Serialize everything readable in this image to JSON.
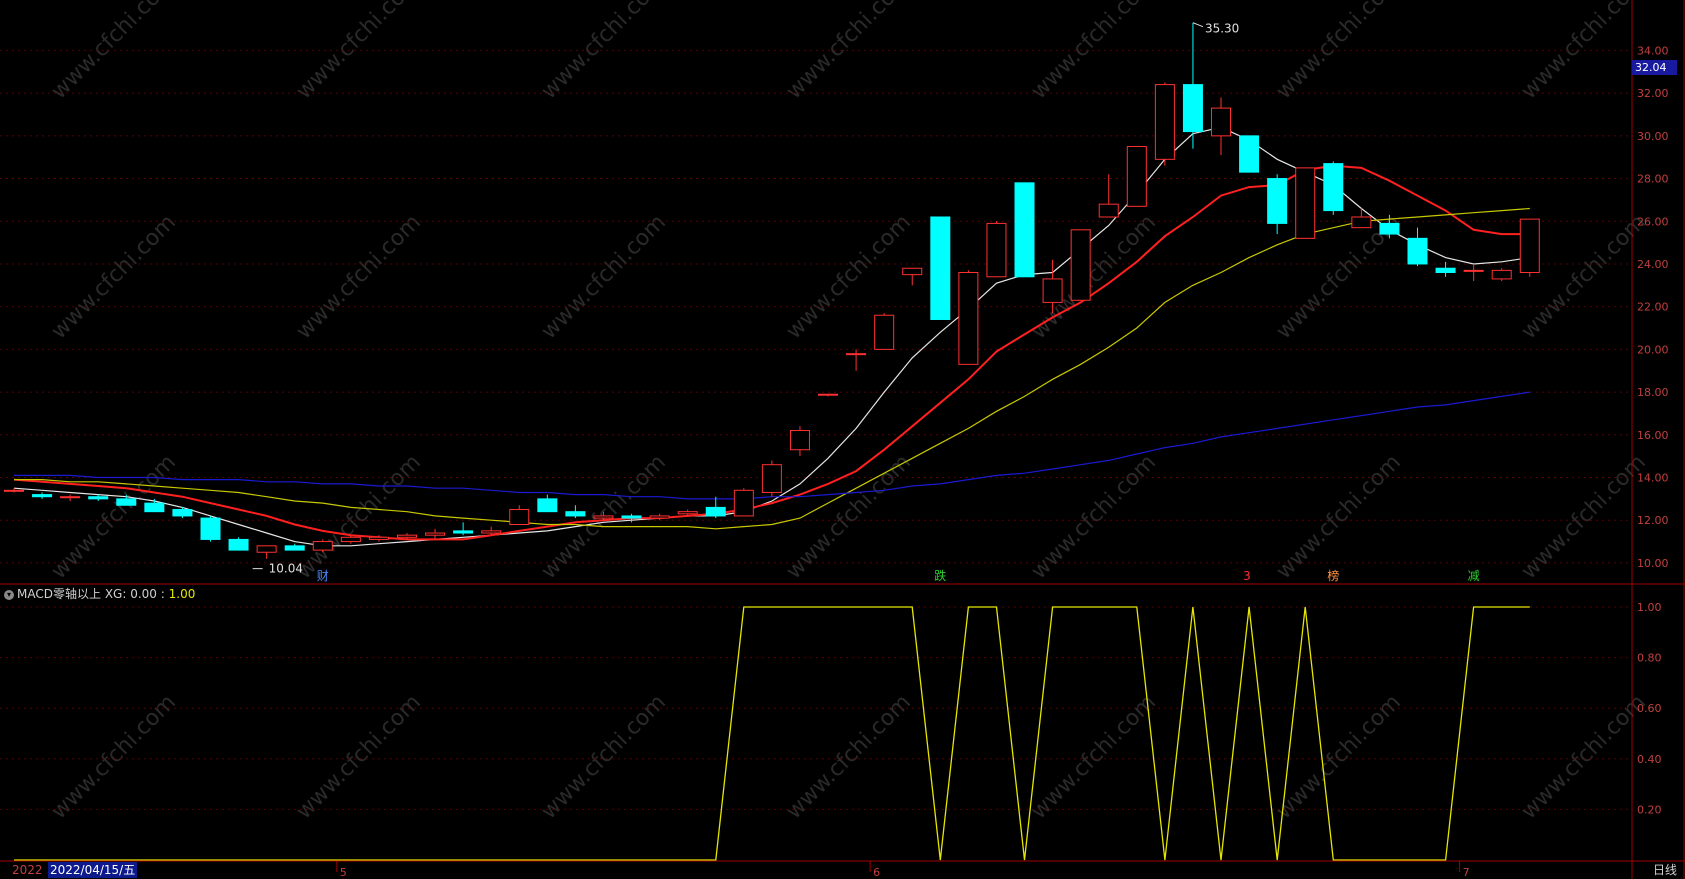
{
  "chart_data": [
    {
      "type": "candlestick",
      "y_ticks": [
        "10.00",
        "12.00",
        "14.00",
        "16.00",
        "18.00",
        "20.00",
        "22.00",
        "24.00",
        "26.00",
        "28.00",
        "30.00",
        "32.00",
        "34.00"
      ],
      "ylim": [
        9.2,
        35.8
      ],
      "x_month_labels": [
        {
          "index": 12,
          "label": "5"
        },
        {
          "index": 31,
          "label": "6"
        },
        {
          "index": 52,
          "label": "7"
        }
      ],
      "candles": [
        [
          13.4,
          13.5,
          13.3,
          13.4
        ],
        [
          13.2,
          13.3,
          13.0,
          13.1
        ],
        [
          13.1,
          13.2,
          12.9,
          13.1
        ],
        [
          13.1,
          13.2,
          12.9,
          13.0
        ],
        [
          13.0,
          13.2,
          12.8,
          12.7
        ],
        [
          12.8,
          13.0,
          12.4,
          12.4
        ],
        [
          12.5,
          12.6,
          12.1,
          12.2
        ],
        [
          12.1,
          12.2,
          11.0,
          11.1
        ],
        [
          11.1,
          11.2,
          10.6,
          10.6
        ],
        [
          10.5,
          10.8,
          10.2,
          10.8
        ],
        [
          10.8,
          10.9,
          10.6,
          10.6
        ],
        [
          10.6,
          11.1,
          10.5,
          11.0
        ],
        [
          11.0,
          11.3,
          10.9,
          11.2
        ],
        [
          11.1,
          11.3,
          11.0,
          11.2
        ],
        [
          11.2,
          11.4,
          11.1,
          11.3
        ],
        [
          11.3,
          11.6,
          11.1,
          11.4
        ],
        [
          11.5,
          11.9,
          11.3,
          11.4
        ],
        [
          11.4,
          11.7,
          11.3,
          11.5
        ],
        [
          11.8,
          12.7,
          11.8,
          12.5
        ],
        [
          13.0,
          13.2,
          12.5,
          12.4
        ],
        [
          12.4,
          12.7,
          12.1,
          12.2
        ],
        [
          12.1,
          12.4,
          12.0,
          12.2
        ],
        [
          12.2,
          12.3,
          11.9,
          12.1
        ],
        [
          12.1,
          12.3,
          12.0,
          12.2
        ],
        [
          12.3,
          12.5,
          12.2,
          12.4
        ],
        [
          12.6,
          13.1,
          12.1,
          12.2
        ],
        [
          12.2,
          13.5,
          12.2,
          13.4
        ],
        [
          13.3,
          14.8,
          13.1,
          14.6
        ],
        [
          15.3,
          16.4,
          15.0,
          16.2
        ],
        [
          17.9,
          17.9,
          17.8,
          17.9
        ],
        [
          19.8,
          20.0,
          19.0,
          19.8
        ],
        [
          20.0,
          21.7,
          20.0,
          21.6
        ],
        [
          23.5,
          23.8,
          23.0,
          23.8
        ],
        [
          26.2,
          26.2,
          21.4,
          21.4
        ],
        [
          19.3,
          23.7,
          19.3,
          23.6
        ],
        [
          23.4,
          26.0,
          23.4,
          25.9
        ],
        [
          27.8,
          27.8,
          23.4,
          23.4
        ],
        [
          22.2,
          24.2,
          21.7,
          23.3
        ],
        [
          22.3,
          25.6,
          22.3,
          25.6
        ],
        [
          26.2,
          28.2,
          26.2,
          26.8
        ],
        [
          26.7,
          29.5,
          26.7,
          29.5
        ],
        [
          28.9,
          32.5,
          28.6,
          32.4
        ],
        [
          32.4,
          35.3,
          29.4,
          30.2
        ],
        [
          30.0,
          31.8,
          29.1,
          31.3
        ],
        [
          30.0,
          30.0,
          28.3,
          28.3
        ],
        [
          28.0,
          28.2,
          25.4,
          25.9
        ],
        [
          25.2,
          28.5,
          25.2,
          28.5
        ],
        [
          28.7,
          28.8,
          26.3,
          26.5
        ],
        [
          25.7,
          26.6,
          25.7,
          26.2
        ],
        [
          25.9,
          26.3,
          25.2,
          25.4
        ],
        [
          25.2,
          25.7,
          23.9,
          24.0
        ],
        [
          23.8,
          24.1,
          23.4,
          23.6
        ],
        [
          23.7,
          24.0,
          23.2,
          23.7
        ],
        [
          23.3,
          23.8,
          23.2,
          23.7
        ],
        [
          23.6,
          24.0,
          23.4,
          26.1
        ]
      ],
      "ma": [
        {
          "color": "#e6e6e6",
          "values": [
            13.5,
            13.4,
            13.3,
            13.2,
            13.1,
            12.9,
            12.6,
            12.2,
            11.8,
            11.4,
            11.0,
            10.8,
            10.8,
            10.9,
            11.0,
            11.1,
            11.2,
            11.3,
            11.4,
            11.5,
            11.7,
            11.9,
            12.0,
            12.1,
            12.2,
            12.2,
            12.4,
            12.9,
            13.7,
            14.9,
            16.3,
            18.0,
            19.6,
            20.8,
            21.9,
            23.1,
            23.5,
            23.6,
            24.7,
            25.8,
            27.3,
            28.9,
            30.1,
            30.4,
            29.8,
            28.9,
            28.3,
            27.7,
            26.6,
            25.6,
            24.9,
            24.3,
            24.0,
            24.1,
            24.3
          ]
        },
        {
          "color": "#ff2020",
          "values": [
            13.9,
            13.8,
            13.7,
            13.6,
            13.5,
            13.3,
            13.1,
            12.8,
            12.5,
            12.2,
            11.8,
            11.5,
            11.3,
            11.2,
            11.1,
            11.1,
            11.1,
            11.3,
            11.5,
            11.7,
            11.9,
            12.0,
            12.1,
            12.1,
            12.2,
            12.3,
            12.5,
            12.8,
            13.2,
            13.7,
            14.3,
            15.3,
            16.4,
            17.5,
            18.6,
            19.9,
            20.7,
            21.5,
            22.2,
            23.1,
            24.1,
            25.3,
            26.2,
            27.2,
            27.6,
            27.7,
            28.4,
            28.6,
            28.5,
            27.9,
            27.2,
            26.5,
            25.6,
            25.4,
            25.4
          ]
        },
        {
          "color": "#c8c800",
          "values": [
            13.9,
            13.9,
            13.8,
            13.8,
            13.7,
            13.6,
            13.5,
            13.4,
            13.3,
            13.1,
            12.9,
            12.8,
            12.6,
            12.5,
            12.4,
            12.2,
            12.1,
            12.0,
            11.9,
            11.8,
            11.8,
            11.7,
            11.7,
            11.7,
            11.7,
            11.6,
            11.7,
            11.8,
            12.1,
            12.8,
            13.5,
            14.2,
            14.9,
            15.6,
            16.3,
            17.1,
            17.8,
            18.6,
            19.3,
            20.1,
            21.0,
            22.2,
            23.0,
            23.6,
            24.3,
            24.9,
            25.4,
            25.7,
            26.0,
            26.1,
            26.2,
            26.3,
            26.4,
            26.5,
            26.6
          ]
        },
        {
          "color": "#1a1ad0",
          "values": [
            14.1,
            14.1,
            14.1,
            14.0,
            14.0,
            14.0,
            13.9,
            13.9,
            13.9,
            13.8,
            13.8,
            13.7,
            13.7,
            13.6,
            13.6,
            13.5,
            13.5,
            13.4,
            13.3,
            13.3,
            13.2,
            13.2,
            13.1,
            13.1,
            13.0,
            13.0,
            13.0,
            13.1,
            13.1,
            13.2,
            13.3,
            13.4,
            13.6,
            13.7,
            13.9,
            14.1,
            14.2,
            14.4,
            14.6,
            14.8,
            15.1,
            15.4,
            15.6,
            15.9,
            16.1,
            16.3,
            16.5,
            16.7,
            16.9,
            17.1,
            17.3,
            17.4,
            17.6,
            17.8,
            18.0
          ]
        }
      ],
      "annotations": {
        "high_label": "35.30",
        "low_label": "10.04",
        "last_price": "32.04",
        "event_markers": [
          {
            "index": 11,
            "label": "财",
            "color": "#4a8cff"
          },
          {
            "index": 33,
            "label": "跌",
            "color": "#30d030"
          },
          {
            "index": 44,
            "label": "3",
            "color": "#ff3030"
          },
          {
            "index": 47,
            "label": "榜",
            "color": "#ff9040"
          },
          {
            "index": 52,
            "label": "减",
            "color": "#30d030"
          }
        ]
      }
    },
    {
      "type": "line",
      "title": "MACD零轴以上",
      "series": [
        {
          "name": "XG",
          "values": [
            0,
            0,
            0,
            0,
            0,
            0,
            0,
            0,
            0,
            0,
            0,
            0,
            0,
            0,
            0,
            0,
            0,
            0,
            0,
            0,
            0,
            0,
            0,
            0,
            0,
            0,
            1,
            1,
            1,
            1,
            1,
            1,
            1,
            0,
            1,
            1,
            0,
            1,
            1,
            1,
            1,
            0,
            1,
            0,
            1,
            0,
            1,
            0,
            0,
            0,
            0,
            0,
            1,
            1,
            1
          ]
        }
      ],
      "y_ticks": [
        "0.20",
        "0.40",
        "0.60",
        "0.80",
        "1.00"
      ],
      "ylim": [
        0,
        1
      ]
    }
  ],
  "indicator": {
    "title": "MACD零轴以上",
    "xg_label": "XG: 0.00",
    "sep": ":",
    "xg_value": "1.00"
  },
  "footer": {
    "year": "2022",
    "date": "2022/04/15/五",
    "period": "日线"
  },
  "watermark": "www.cfchi.com"
}
